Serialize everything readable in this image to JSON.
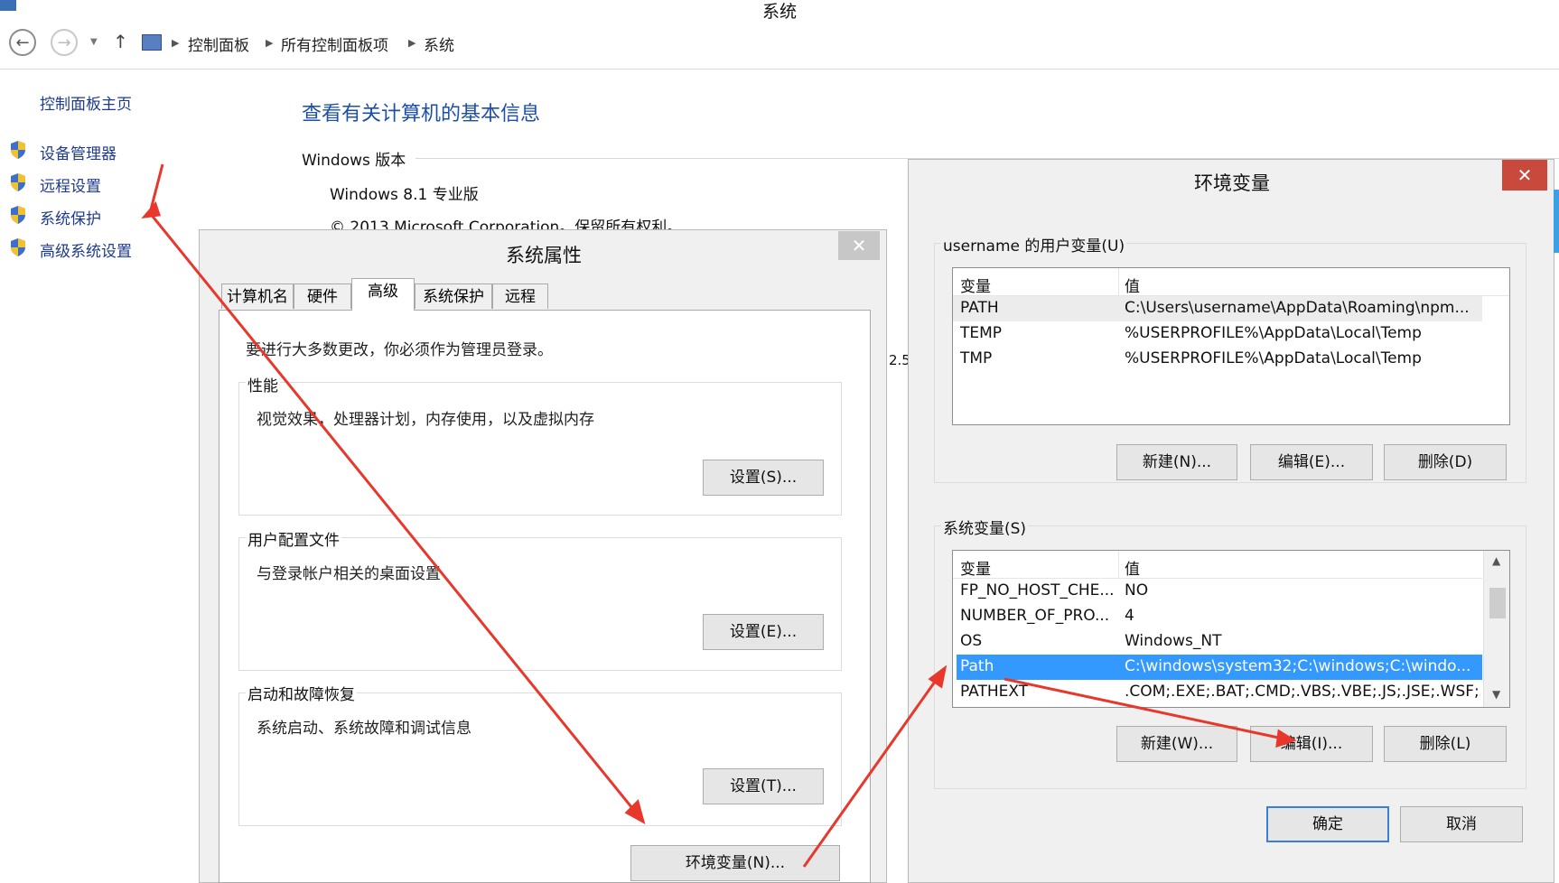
{
  "window": {
    "title": "系统",
    "breadcrumb": [
      "控制面板",
      "所有控制面板项",
      "系统"
    ]
  },
  "sidebar": {
    "home": "控制面板主页",
    "links": [
      "设备管理器",
      "远程设置",
      "系统保护",
      "高级系统设置"
    ]
  },
  "main": {
    "heading": "查看有关计算机的基本信息",
    "section": "Windows 版本",
    "edition": "Windows 8.1 专业版",
    "copyright": "© 2013 Microsoft Corporation。保留所有权利。",
    "partial": "2.5"
  },
  "sysprops": {
    "title": "系统属性",
    "close": "✕",
    "tabs": [
      "计算机名",
      "硬件",
      "高级",
      "系统保护",
      "远程"
    ],
    "admin_note": "要进行大多数更改，你必须作为管理员登录。",
    "groups": [
      {
        "label": "性能",
        "desc": "视觉效果，处理器计划，内存使用，以及虚拟内存",
        "button": "设置(S)..."
      },
      {
        "label": "用户配置文件",
        "desc": "与登录帐户相关的桌面设置",
        "button": "设置(E)..."
      },
      {
        "label": "启动和故障恢复",
        "desc": "系统启动、系统故障和调试信息",
        "button": "设置(T)..."
      }
    ],
    "env_button": "环境变量(N)..."
  },
  "envvars": {
    "title": "环境变量",
    "close": "✕",
    "user_group": "username 的用户变量(U)",
    "col_var": "变量",
    "col_val": "值",
    "user_rows": [
      {
        "var": "PATH",
        "val": "C:\\Users\\username\\AppData\\Roaming\\npm..."
      },
      {
        "var": "TEMP",
        "val": "%USERPROFILE%\\AppData\\Local\\Temp"
      },
      {
        "var": "TMP",
        "val": "%USERPROFILE%\\AppData\\Local\\Temp"
      }
    ],
    "user_buttons": [
      "新建(N)...",
      "编辑(E)...",
      "删除(D)"
    ],
    "sys_group": "系统变量(S)",
    "sys_rows": [
      {
        "var": "FP_NO_HOST_CHE...",
        "val": "NO"
      },
      {
        "var": "NUMBER_OF_PRO...",
        "val": "4"
      },
      {
        "var": "OS",
        "val": "Windows_NT"
      },
      {
        "var": "Path",
        "val": "C:\\windows\\system32;C:\\windows;C:\\windo..."
      },
      {
        "var": "PATHEXT",
        "val": ".COM;.EXE;.BAT;.CMD;.VBS;.VBE;.JS;.JSE;.WSF;..."
      }
    ],
    "sys_buttons": [
      "新建(W)...",
      "编辑(I)...",
      "删除(L)"
    ],
    "ok": "确定",
    "cancel": "取消"
  },
  "colors": {
    "accent": "#3399ff",
    "link": "#1e3b8c",
    "arrow": "#e8372b",
    "close": "#c94a3c"
  }
}
